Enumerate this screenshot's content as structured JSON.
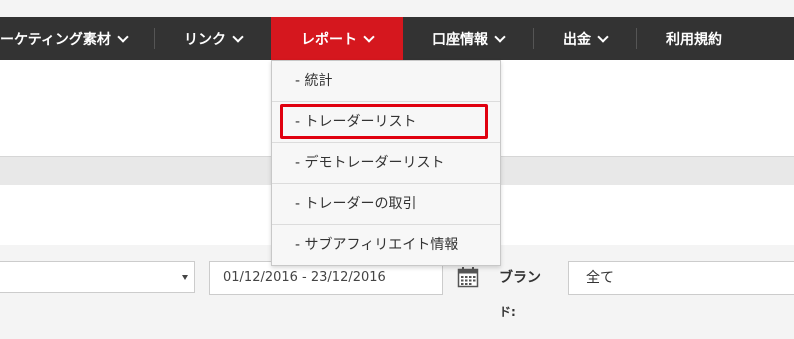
{
  "nav": {
    "items": [
      {
        "label": "ーケティング素材",
        "chevron": true
      },
      {
        "label": "リンク",
        "chevron": true
      },
      {
        "label": "レポート",
        "chevron": true,
        "active": true
      },
      {
        "label": "口座情報",
        "chevron": true
      },
      {
        "label": "出金",
        "chevron": true
      },
      {
        "label": "利用規約",
        "chevron": false
      }
    ]
  },
  "report_menu": {
    "items": [
      {
        "label": "- 統計"
      },
      {
        "label": "- トレーダーリスト",
        "highlighted": true
      },
      {
        "label": "- デモトレーダーリスト"
      },
      {
        "label": "- トレーダーの取引"
      },
      {
        "label": "- サブアフィリエイト情報"
      }
    ]
  },
  "filters": {
    "date_range": "01/12/2016 - 23/12/2016",
    "brand_label_line1": "ブラン",
    "brand_label_line2": "ド:",
    "brand_value": "全て"
  },
  "colors": {
    "navbar": "#333333",
    "active_tab": "#d5171e",
    "highlight_border": "#e0000f"
  }
}
